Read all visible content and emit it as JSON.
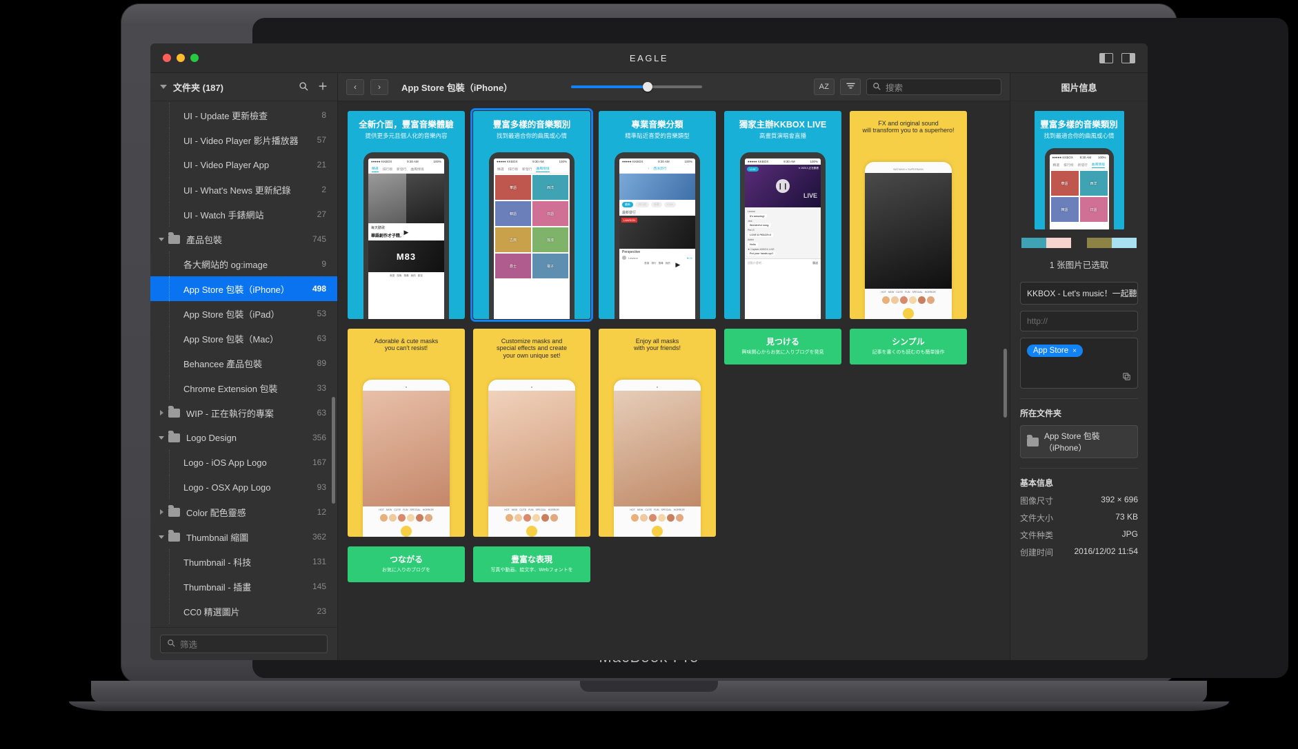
{
  "device": {
    "label": "MacBook Pro"
  },
  "window": {
    "title": "EAGLE",
    "traffic": [
      "close-button",
      "minimize-button",
      "maximize-button"
    ],
    "left_panel_toggle": "left-panel-toggle",
    "right_panel_toggle": "right-panel-toggle"
  },
  "sidebar": {
    "title": "文件夹 (187)",
    "search_icon": "search-icon",
    "add_icon": "plus-icon",
    "items": [
      {
        "label": "UI - Update 更新檢查",
        "count": "8",
        "level": 1,
        "twisty": "",
        "folder": false
      },
      {
        "label": "UI - Video Player 影片播放器",
        "count": "57",
        "level": 1,
        "twisty": "",
        "folder": false
      },
      {
        "label": "UI - Video Player App",
        "count": "21",
        "level": 1,
        "twisty": "",
        "folder": false
      },
      {
        "label": "UI - What's News 更新紀錄",
        "count": "2",
        "level": 1,
        "twisty": "",
        "folder": false
      },
      {
        "label": "UI - Watch 手錶網站",
        "count": "27",
        "level": 1,
        "twisty": "",
        "folder": false
      },
      {
        "label": "產品包裝",
        "count": "745",
        "level": 0,
        "twisty": "down",
        "folder": true
      },
      {
        "label": "各大網站的 og:image",
        "count": "9",
        "level": 1,
        "twisty": "",
        "folder": false
      },
      {
        "label": "App Store 包裝（iPhone）",
        "count": "498",
        "level": 1,
        "twisty": "",
        "folder": false,
        "selected": true
      },
      {
        "label": "App Store 包裝（iPad）",
        "count": "53",
        "level": 1,
        "twisty": "",
        "folder": false
      },
      {
        "label": "App Store 包裝（Mac）",
        "count": "63",
        "level": 1,
        "twisty": "",
        "folder": false
      },
      {
        "label": "Behancee 產品包裝",
        "count": "89",
        "level": 1,
        "twisty": "",
        "folder": false
      },
      {
        "label": "Chrome Extension 包裝",
        "count": "33",
        "level": 1,
        "twisty": "",
        "folder": false
      },
      {
        "label": "WIP - 正在執行的專案",
        "count": "63",
        "level": 0,
        "twisty": "right",
        "folder": true
      },
      {
        "label": "Logo Design",
        "count": "356",
        "level": 0,
        "twisty": "down",
        "folder": true
      },
      {
        "label": "Logo - iOS App Logo",
        "count": "167",
        "level": 1,
        "twisty": "",
        "folder": false
      },
      {
        "label": "Logo - OSX App Logo",
        "count": "93",
        "level": 1,
        "twisty": "",
        "folder": false
      },
      {
        "label": "Color 配色靈感",
        "count": "12",
        "level": 0,
        "twisty": "right",
        "folder": true
      },
      {
        "label": "Thumbnail 縮圖",
        "count": "362",
        "level": 0,
        "twisty": "down",
        "folder": true
      },
      {
        "label": "Thumbnail - 科技",
        "count": "131",
        "level": 1,
        "twisty": "",
        "folder": false
      },
      {
        "label": "Thumbnail - 插畫",
        "count": "145",
        "level": 1,
        "twisty": "",
        "folder": false
      },
      {
        "label": "CC0 精選圖片",
        "count": "23",
        "level": 1,
        "twisty": "",
        "folder": false
      }
    ],
    "filter": {
      "placeholder": "筛选",
      "value": "",
      "icon": "search-icon"
    }
  },
  "toolbar": {
    "back_label": "‹",
    "forward_label": "›",
    "breadcrumb": "App Store 包裝（iPhone）",
    "zoom_percent": 58,
    "sort_label": "AZ",
    "filter_icon": "filter-icon",
    "search": {
      "placeholder": "搜索",
      "value": "",
      "icon": "search-icon"
    }
  },
  "grid": {
    "rows": [
      {
        "style": "blue",
        "cards": [
          {
            "h1": "全新介面，豐富音樂體驗",
            "h2": "提供更多元且個人化的音樂內容",
            "kind": "kkbox-feed",
            "selected": false
          },
          {
            "h1": "豐富多樣的音樂類別",
            "h2": "找到最適合你的曲風或心情",
            "kind": "kkbox-tiles",
            "selected": true
          },
          {
            "h1": "專業音樂分類",
            "h2": "精準貼近喜愛的音樂類型",
            "kind": "kkbox-chart",
            "selected": false
          },
          {
            "h1": "獨家主辦KKBOX LIVE",
            "h2": "高畫質演唱會直播",
            "kind": "kkbox-live",
            "selected": false
          }
        ]
      },
      {
        "style": "yellow",
        "cards": [
          {
            "h1": "FX and original sound\nwill transform you to a superhero!",
            "kind": "mask-batman",
            "selected": false
          },
          {
            "h1": "Adorable & cute masks\nyou can't resist!",
            "kind": "mask-bunny",
            "selected": false
          },
          {
            "h1": "Customize masks and\nspecial effects and create\nyour own unique set!",
            "kind": "mask-custom",
            "selected": false
          },
          {
            "h1": "Enjoy all masks\nwith your friends!",
            "kind": "mask-friends",
            "selected": false
          }
        ]
      },
      {
        "style": "green",
        "cards": [
          {
            "h1": "見つける",
            "h2": "興味関心からお気に入りブログを発見",
            "kind": "blog",
            "selected": false
          },
          {
            "h1": "シンプル",
            "h2": "記事を書くのも読むのも簡単操作",
            "kind": "blog",
            "selected": false
          },
          {
            "h1": "つながる",
            "h2": "お気に入りのブログを",
            "kind": "blog",
            "selected": false
          },
          {
            "h1": "豊富な表現",
            "h2": "写真や動画、絵文字、Webフォントを",
            "kind": "blog",
            "selected": false
          }
        ]
      }
    ]
  },
  "info_panel": {
    "title": "图片信息",
    "preview": {
      "h1": "豐富多樣的音樂類別",
      "h2": "找到最適合你的曲風或心情"
    },
    "palette": [
      "#3fa3b4",
      "#f6d3cd",
      "#8d8344",
      "#a8e2f2"
    ],
    "selection_text": "1 张图片已选取",
    "name_field": {
      "value": "KKBOX - Let's music！一起聽音樂吧"
    },
    "url_field": {
      "value": "",
      "placeholder": "http://"
    },
    "tags": [
      {
        "label": "App Store",
        "remove": "×"
      }
    ],
    "copy_icon": "copy-icon",
    "folder_section": {
      "title": "所在文件夹",
      "folder": "App Store 包裝（iPhone）",
      "icon": "folder-icon"
    },
    "basic_section": {
      "title": "基本信息",
      "rows": [
        {
          "key": "图像尺寸",
          "value": "392 × 696"
        },
        {
          "key": "文件大小",
          "value": "73 KB"
        },
        {
          "key": "文件种类",
          "value": "JPG"
        },
        {
          "key": "创建时间",
          "value": "2016/12/02 11:54"
        }
      ]
    }
  },
  "colors": {
    "accent": "#1283f5",
    "selection": "#0a74f0",
    "ad_blue": "#19b0d8",
    "ad_yellow": "#f7cf46",
    "ad_green": "#2ecc76"
  }
}
